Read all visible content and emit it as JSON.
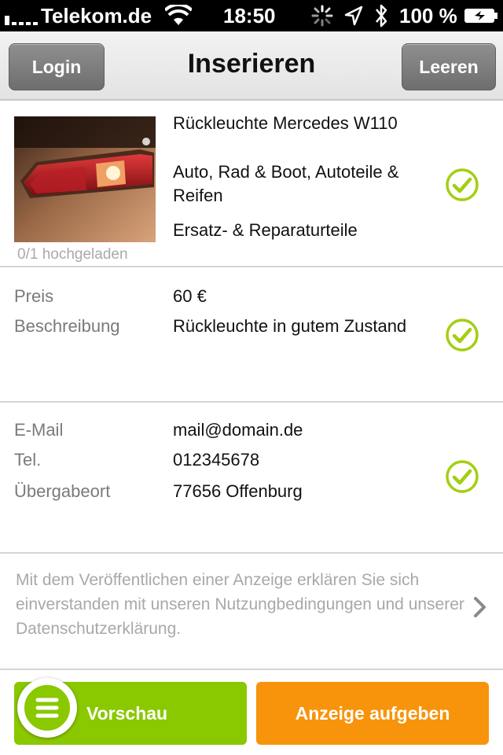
{
  "status_bar": {
    "carrier": "Telekom.de",
    "time": "18:50",
    "battery": "100 %"
  },
  "nav": {
    "login_label": "Login",
    "title": "Inserieren",
    "clear_label": "Leeren"
  },
  "item": {
    "title": "Rückleuchte Mercedes W110",
    "category": "Auto, Rad & Boot, Autoteile & Reifen",
    "subcategory": "Ersatz- & Reparaturteile",
    "upload_status": "0/1 hochgeladen"
  },
  "details": {
    "price_label": "Preis",
    "price_value": "60 €",
    "description_label": "Beschreibung",
    "description_value": "Rückleuchte in gutem Zustand"
  },
  "contact": {
    "email_label": "E-Mail",
    "email_value": "mail@domain.de",
    "phone_label": "Tel.",
    "phone_value": "012345678",
    "location_label": "Übergabeort",
    "location_value": "77656 Offenburg"
  },
  "legal_text": "Mit dem Veröffentlichen einer Anzeige erklären Sie sich einverstanden mit unseren Nutzungbedingungen und unserer Datenschutzerklärung.",
  "actions": {
    "preview_label": "Vorschau",
    "publish_label": "Anzeige aufgeben"
  },
  "colors": {
    "accent_green": "#8ac800",
    "accent_orange": "#f7940b",
    "check_green": "#a3cf11"
  },
  "icons": [
    "signal-icon",
    "wifi-icon",
    "activity-spinner-icon",
    "location-arrow-icon",
    "bluetooth-icon",
    "battery-icon",
    "checkmark-icon",
    "chevron-right-icon",
    "menu-icon"
  ]
}
